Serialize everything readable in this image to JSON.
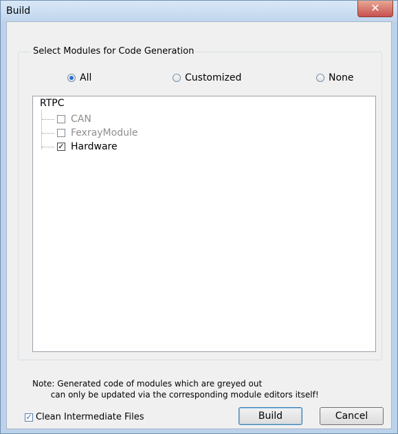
{
  "window": {
    "title": "Build",
    "close_symbol": "✕"
  },
  "group": {
    "legend": "Select Modules for Code Generation"
  },
  "radios": {
    "all": {
      "label": "All",
      "checked": true
    },
    "customized": {
      "label": "Customized",
      "checked": false
    },
    "none": {
      "label": "None",
      "checked": false
    }
  },
  "tree": {
    "root": "RTPC",
    "items": [
      {
        "label": "CAN",
        "checked": false,
        "enabled": false
      },
      {
        "label": "FexrayModule",
        "checked": false,
        "enabled": false
      },
      {
        "label": "Hardware",
        "checked": true,
        "enabled": true
      }
    ]
  },
  "note": {
    "line1": "Note: Generated code of modules which are greyed out",
    "line2": "       can only be updated via the corresponding module editors itself!"
  },
  "options": {
    "clean_label": "Clean Intermediate Files",
    "clean_checked": true
  },
  "buttons": {
    "build": "Build",
    "cancel": "Cancel"
  }
}
